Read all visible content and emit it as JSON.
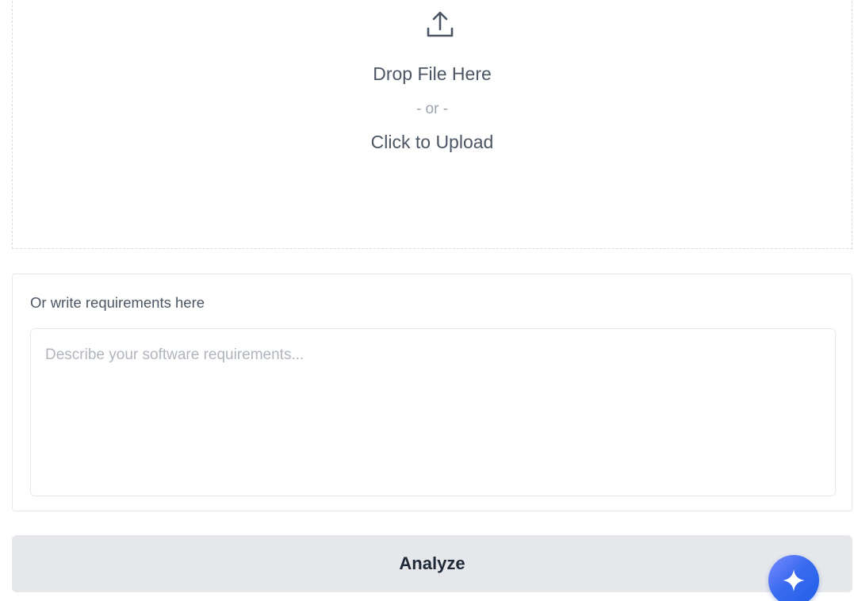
{
  "upload": {
    "icon": "upload-icon",
    "drop_text": "Drop File Here",
    "or_text": "- or -",
    "click_text": "Click to Upload"
  },
  "requirements": {
    "label": "Or write requirements here",
    "placeholder": "Describe your software requirements...",
    "value": ""
  },
  "actions": {
    "analyze_label": "Analyze"
  },
  "assistant": {
    "icon": "sparkle-icon"
  },
  "colors": {
    "button_bg": "#e5e7eb",
    "assistant_gradient_start": "#7c8cff",
    "assistant_gradient_end": "#1f5fe8"
  }
}
